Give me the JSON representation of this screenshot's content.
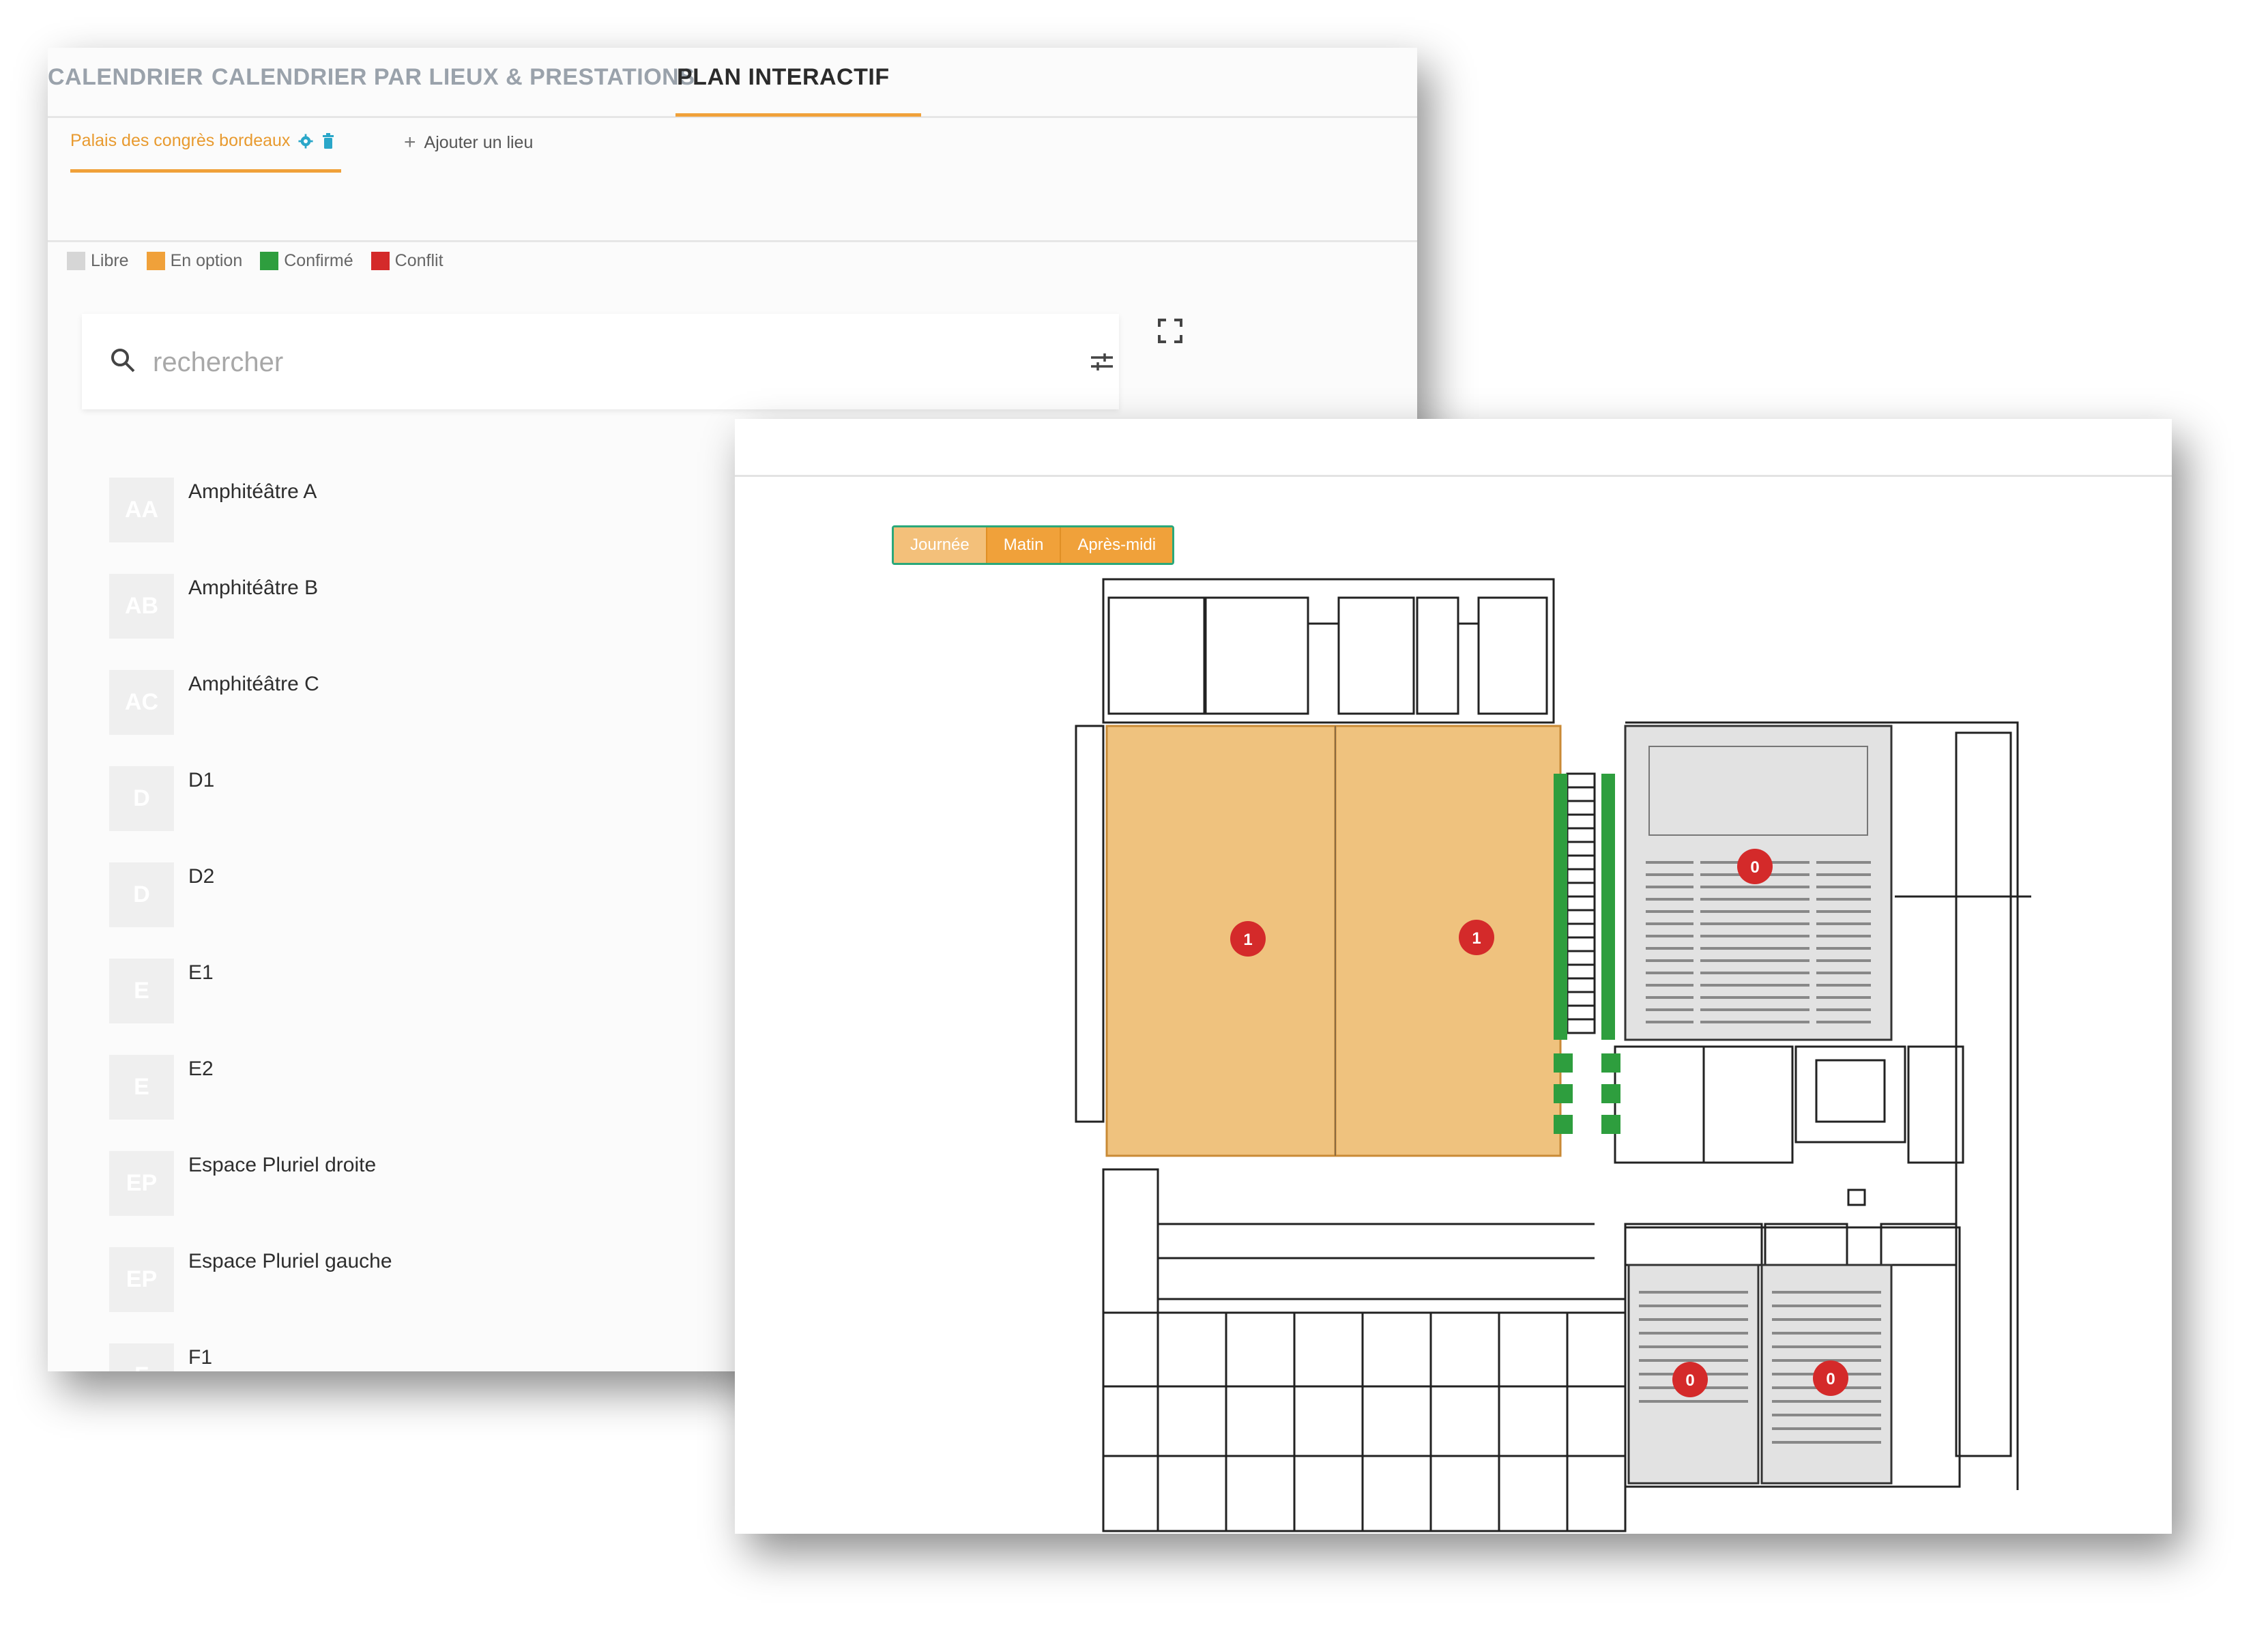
{
  "tabs": [
    {
      "label": "CALENDRIER",
      "active": false
    },
    {
      "label": "CALENDRIER PAR LIEUX & PRESTATIONS",
      "active": false
    },
    {
      "label": "PLAN INTERACTIF",
      "active": true
    }
  ],
  "venue": {
    "name": "Palais des congrès bordeaux",
    "add_label": "Ajouter un lieu"
  },
  "legend": [
    {
      "label": "Libre",
      "color": "#d6d6d6"
    },
    {
      "label": "En option",
      "color": "#f0a13a"
    },
    {
      "label": "Confirmé",
      "color": "#2e9e3e"
    },
    {
      "label": "Conflit",
      "color": "#d42a2a"
    }
  ],
  "search": {
    "placeholder": "rechercher"
  },
  "rooms": [
    {
      "initials": "AA",
      "name": "Amphitéâtre A"
    },
    {
      "initials": "AB",
      "name": "Amphitéâtre B"
    },
    {
      "initials": "AC",
      "name": "Amphitéâtre C"
    },
    {
      "initials": "D",
      "name": "D1"
    },
    {
      "initials": "D",
      "name": "D2"
    },
    {
      "initials": "E",
      "name": "E1"
    },
    {
      "initials": "E",
      "name": "E2"
    },
    {
      "initials": "EP",
      "name": "Espace Pluriel droite"
    },
    {
      "initials": "EP",
      "name": "Espace Pluriel gauche"
    },
    {
      "initials": "F",
      "name": "F1"
    }
  ],
  "time_toggle": {
    "options": [
      "Journée",
      "Matin",
      "Après-midi"
    ],
    "selected": "Journée"
  },
  "plan_markers": [
    {
      "room": "hall-left",
      "count": "1",
      "status": "En option"
    },
    {
      "room": "hall-right",
      "count": "1",
      "status": "En option"
    },
    {
      "room": "amphitheatre-top",
      "count": "0",
      "status": "Libre"
    },
    {
      "room": "amphitheatre-bottom-left",
      "count": "0",
      "status": "Libre"
    },
    {
      "room": "amphitheatre-bottom-right",
      "count": "0",
      "status": "Libre"
    }
  ],
  "colors": {
    "accent": "#f0a13a",
    "option_fill": "#efc27e",
    "confirmed": "#2e9e3e",
    "marker": "#d42a2a",
    "free_fill": "#e2e2e2"
  }
}
